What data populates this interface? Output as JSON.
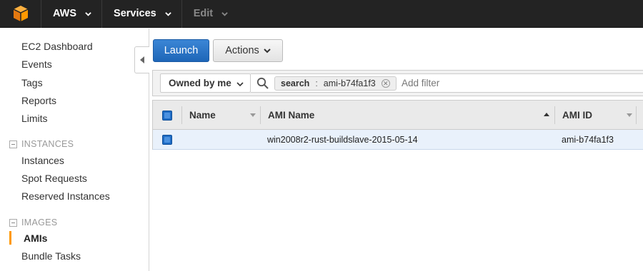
{
  "topnav": {
    "brand": "AWS",
    "services": "Services",
    "edit": "Edit",
    "logo_icon": "aws-cube-icon",
    "logo_color": "#f90"
  },
  "sidebar": {
    "links_top": [
      "EC2 Dashboard",
      "Events",
      "Tags",
      "Reports",
      "Limits"
    ],
    "sections": [
      {
        "title": "INSTANCES",
        "items": [
          "Instances",
          "Spot Requests",
          "Reserved Instances"
        ]
      },
      {
        "title": "IMAGES",
        "items": [
          "AMIs",
          "Bundle Tasks"
        ],
        "active": "AMIs"
      }
    ]
  },
  "toolbar": {
    "launch_label": "Launch",
    "actions_label": "Actions"
  },
  "filter": {
    "owner_select": "Owned by me",
    "token_key": "search",
    "token_sep": ":",
    "token_value": "ami-b74fa1f3",
    "placeholder": "Add filter"
  },
  "table": {
    "columns": [
      "Name",
      "AMI Name",
      "AMI ID"
    ],
    "rows": [
      {
        "name": "",
        "ami_name": "win2008r2-rust-buildslave-2015-05-14",
        "ami_id": "ami-b74fa1f3"
      }
    ]
  },
  "colors": {
    "topbar": "#232323",
    "primary_button": "#1e66b8",
    "selected_row": "#e9f1fb",
    "active_marker": "#f90"
  }
}
